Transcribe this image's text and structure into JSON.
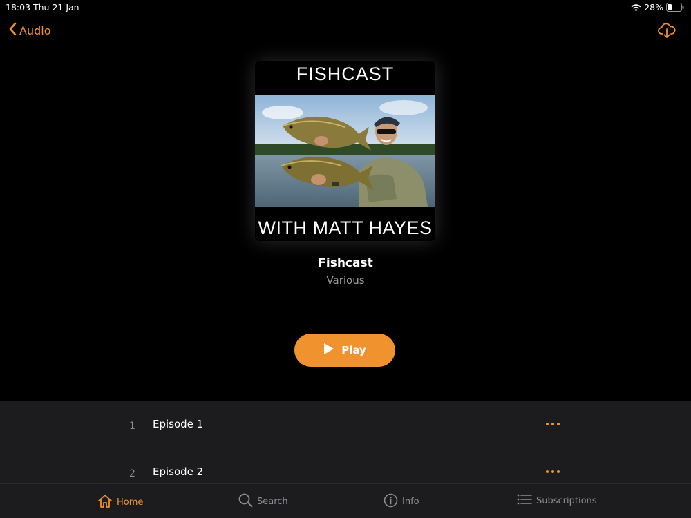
{
  "status_bar": {
    "time": "18:03",
    "date": "Thu 21 Jan",
    "battery": "28%"
  },
  "nav": {
    "back_label": "Audio",
    "back_icon": "chevron-left-icon",
    "download_icon": "cloud-download-icon"
  },
  "artwork": {
    "title_top": "FISHCAST",
    "title_bottom": "WITH MATT HAYES"
  },
  "podcast": {
    "title": "Fishcast",
    "author": "Various"
  },
  "play_button": {
    "label": "Play"
  },
  "episodes": [
    {
      "number": "1",
      "title": "Episode 1"
    },
    {
      "number": "2",
      "title": "Episode 2"
    }
  ],
  "tabs": [
    {
      "label": "Home",
      "icon": "home-icon",
      "active": true
    },
    {
      "label": "Search",
      "icon": "search-icon",
      "active": false
    },
    {
      "label": "Info",
      "icon": "info-icon",
      "active": false
    },
    {
      "label": "Subscriptions",
      "icon": "list-icon",
      "active": false
    }
  ],
  "colors": {
    "accent": "#f0922e",
    "background": "#000000",
    "list_background": "#1c1c1e",
    "secondary_text": "#8e8e93"
  }
}
